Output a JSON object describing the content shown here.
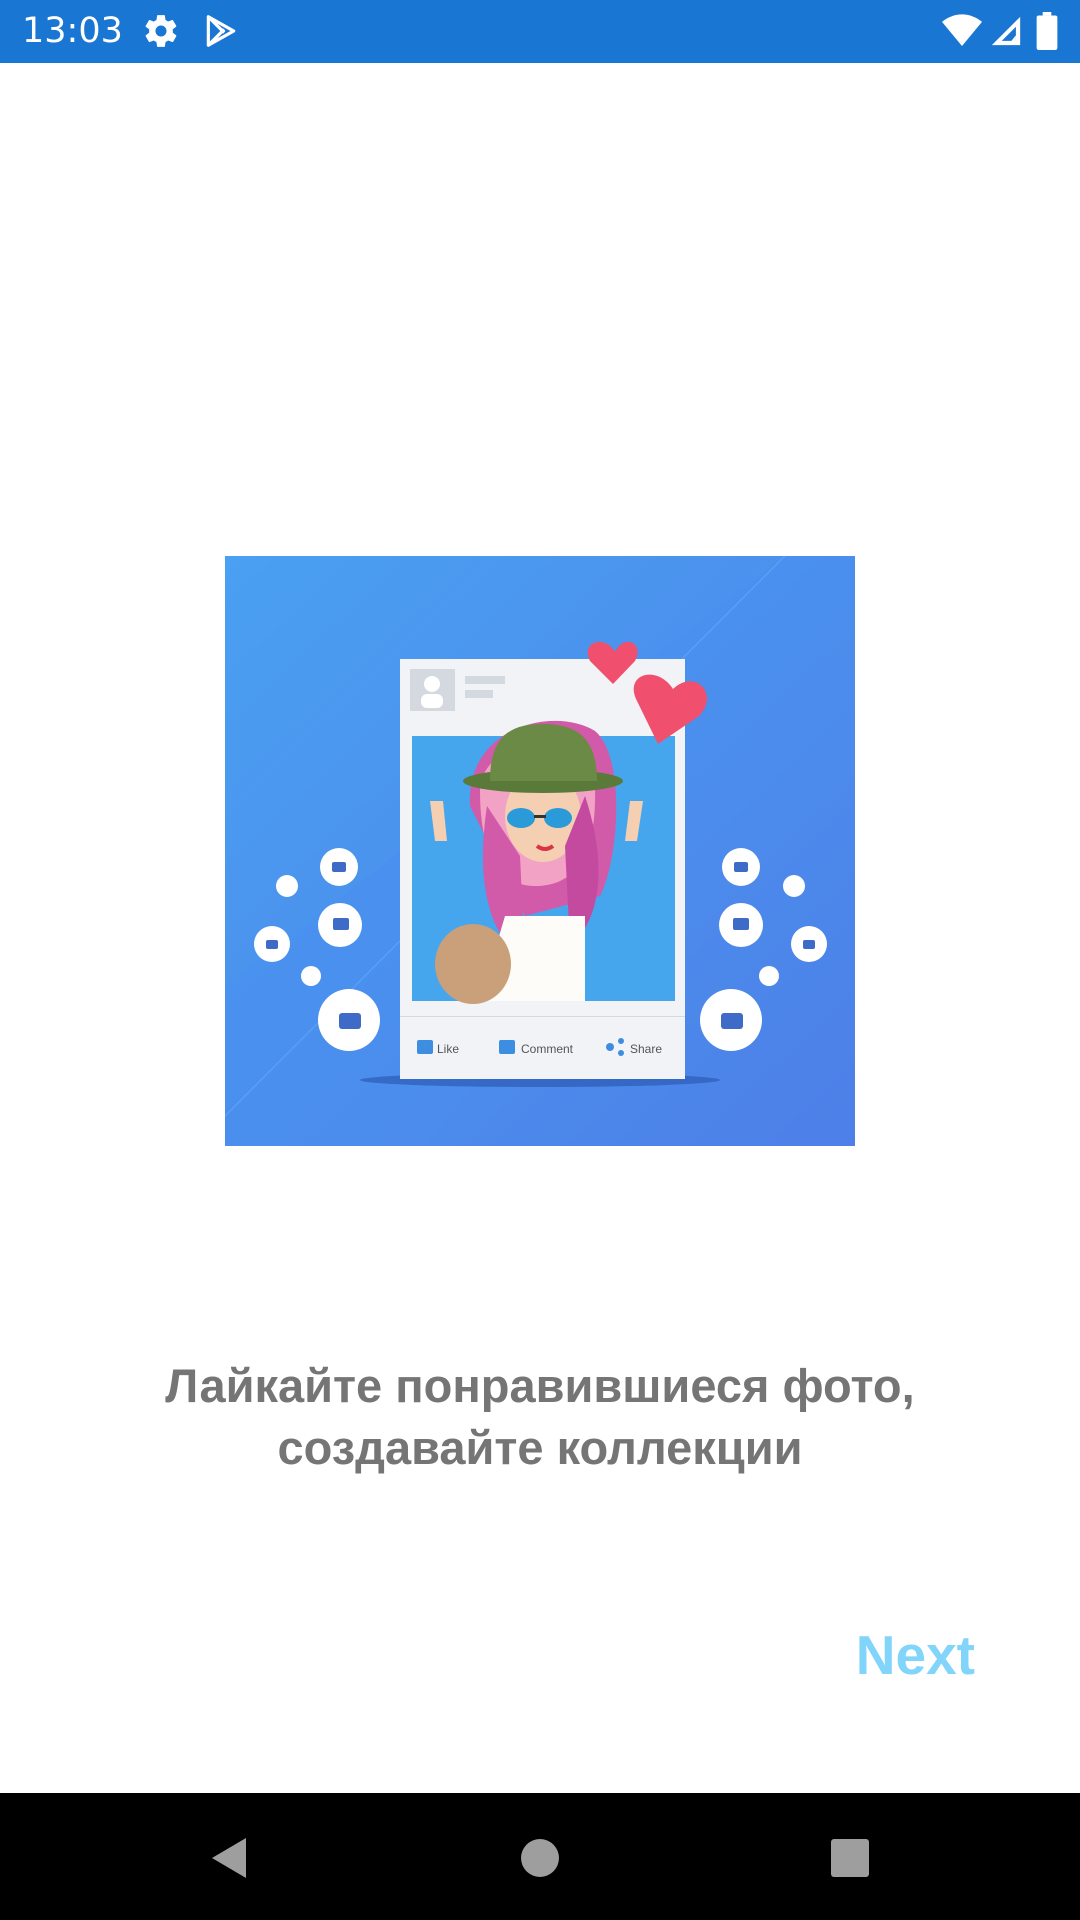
{
  "status_bar": {
    "time": "13:03",
    "background": "#1976d2",
    "icons": [
      "gear-icon",
      "play-store-icon",
      "wifi-icon",
      "signal-icon",
      "battery-icon"
    ]
  },
  "illustration": {
    "background": "#4a8df0",
    "post_actions": [
      "Like",
      "Comment",
      "Share"
    ]
  },
  "caption": {
    "line1": "Лайкайте понравившиеся фото,",
    "line2": "создавайте коллекции",
    "color": "#757575"
  },
  "next_button": {
    "label": "Next",
    "color": "#81d4fa"
  },
  "nav_bar": {
    "buttons": [
      "back-icon",
      "home-icon",
      "recents-icon"
    ]
  }
}
